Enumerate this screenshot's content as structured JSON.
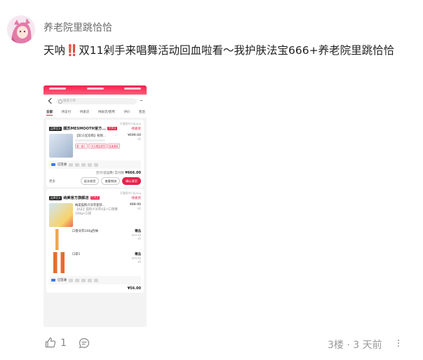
{
  "post": {
    "username": "养老院里跳恰恰",
    "content": "天呐‼️双11剁手来唱舞活动回血啦看～我护肤法宝666+养老院里跳恰恰",
    "likes": "1",
    "floor_time": "3楼 · 3 天前"
  },
  "screenshot": {
    "search_placeholder": "搜索订单",
    "tabs": [
      "全部",
      "待支付",
      "待发货",
      "待收货/使用",
      "评价",
      "售后"
    ],
    "card1": {
      "hint": "天猫超市小店App",
      "store_tag": "品牌官方",
      "store_name": "膜苏MESMOOTH官方...",
      "badge": "已关注",
      "status": "待收货",
      "product_title": "【双11狂欢购】射频...",
      "product_price": "¥699.00",
      "product_qty": "x1",
      "chips": [
        "退一赔十",
        "7天无理由退货",
        "极速退款"
      ],
      "logistics": "已签收",
      "total": "合计(含运费)  实付款 ",
      "total_amount": "¥666.00",
      "more": "更多",
      "buttons": [
        "延长收货",
        "查看物流",
        "确认收货"
      ]
    },
    "card2": {
      "hint": "天猫超市小店App",
      "store_tag": "品牌官方",
      "store_name": "纳美官方旗舰店",
      "badge": "已关注",
      "status": "待收货",
      "product_title": "纳美猫狗爪牙膏套装...",
      "product_price": "¥89.90",
      "product_qty": "x1",
      "product_sub": "【4支】猫狗爪牙膏4支+口香糖",
      "product_sub2": "140g+口袋",
      "gift1_title": "口香牙膏140g西柚",
      "gift1_tag": "赠品",
      "gift1_price": "¥29.90",
      "gift1_qty": "x1",
      "gift2_title": "口袋1",
      "gift2_tag": "赠品",
      "gift2_price": "¥29.90",
      "gift2_qty": "x1",
      "logistics": "已签收",
      "total_amount": "¥56.00"
    }
  },
  "colors": {
    "accent": "#e5224a"
  }
}
